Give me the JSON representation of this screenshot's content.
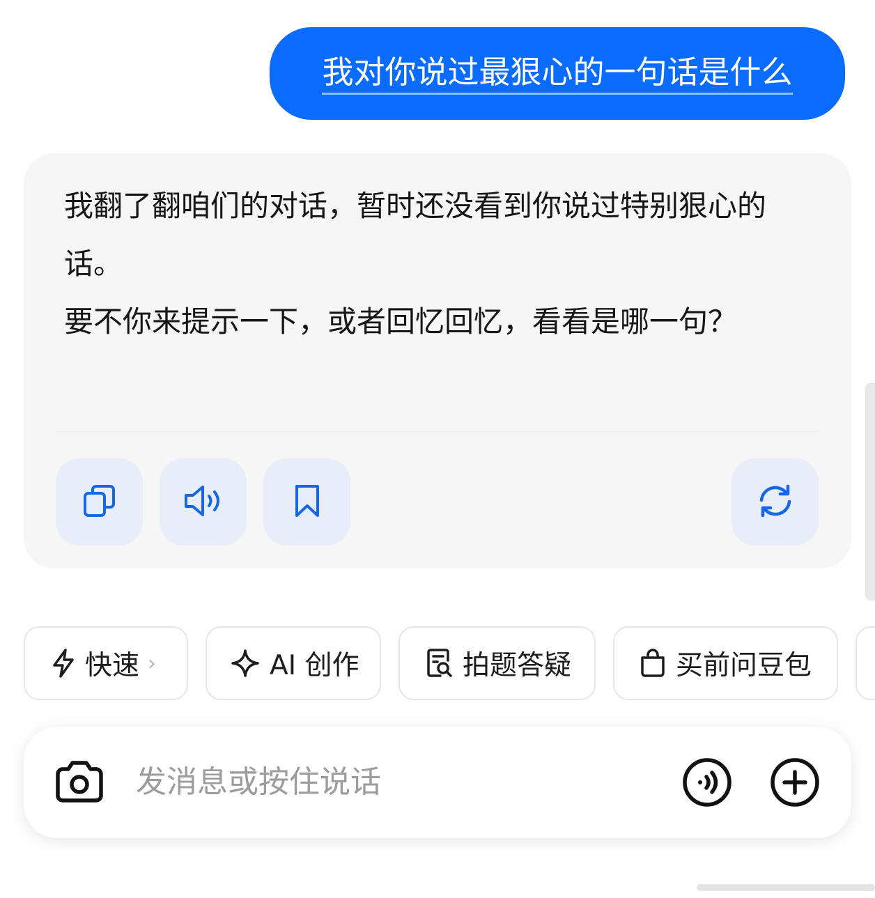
{
  "conversation": {
    "user_message": "我对你说过最狠心的一句话是什么",
    "ai_reply": {
      "paragraph1": "我翻了翻咱们的对话，暂时还没看到你说过特别狠心的话。",
      "paragraph2": "要不你来提示一下，或者回忆回忆，看看是哪一句？"
    },
    "actions": [
      {
        "name": "copy",
        "icon": "copy-icon"
      },
      {
        "name": "read-aloud",
        "icon": "speaker-icon"
      },
      {
        "name": "bookmark",
        "icon": "bookmark-icon"
      },
      {
        "name": "regenerate",
        "icon": "refresh-icon"
      }
    ]
  },
  "shortcuts": [
    {
      "label": "快速",
      "icon": "lightning-icon",
      "has_chevron": true
    },
    {
      "label": "AI 创作",
      "icon": "sparkle-icon"
    },
    {
      "label": "拍题答疑",
      "icon": "document-search-icon"
    },
    {
      "label": "买前问豆包",
      "icon": "shopping-bag-icon"
    }
  ],
  "input": {
    "placeholder": "发消息或按住说话",
    "left_icon": "camera-icon",
    "right_icons": [
      "voice-call-icon",
      "plus-icon"
    ]
  },
  "colors": {
    "accent": "#0a6cff",
    "icon_blue": "#1567e6",
    "action_bg": "#e7edf9",
    "card_bg": "#f6f6f6"
  }
}
